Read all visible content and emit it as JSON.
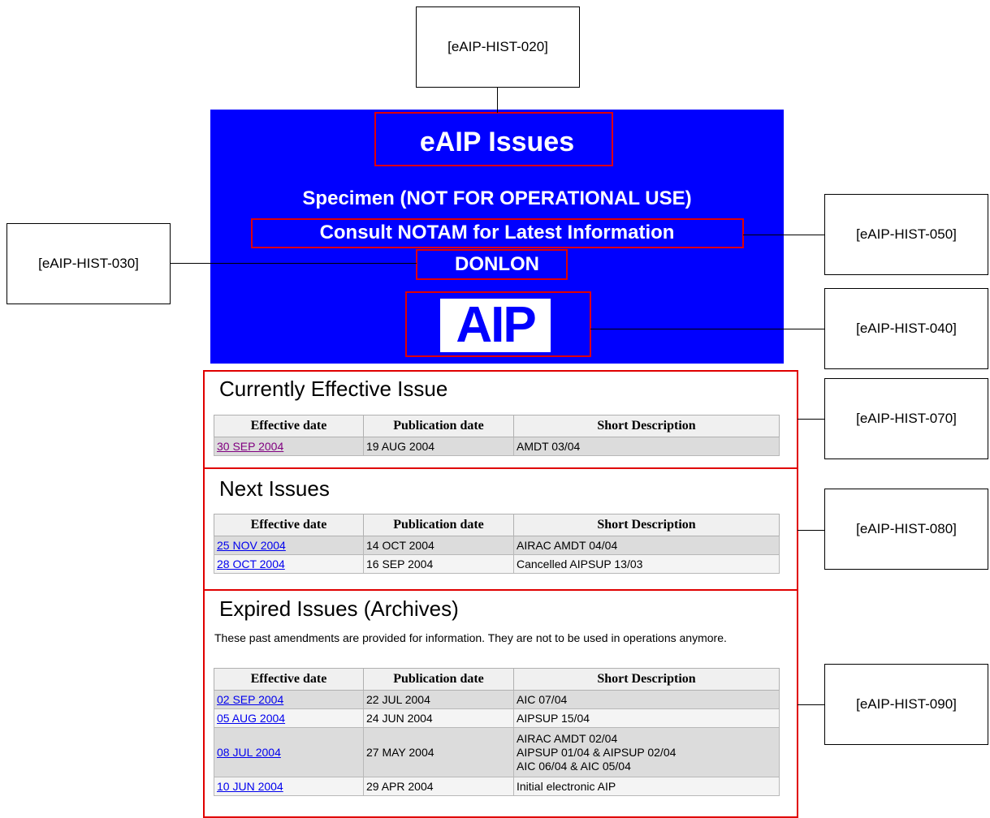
{
  "callouts": {
    "c020": "[eAIP-HIST-020]",
    "c030": "[eAIP-HIST-030]",
    "c050": "[eAIP-HIST-050]",
    "c040": "[eAIP-HIST-040]",
    "c070": "[eAIP-HIST-070]",
    "c080": "[eAIP-HIST-080]",
    "c090": "[eAIP-HIST-090]"
  },
  "banner": {
    "title": "eAIP Issues",
    "specimen": "Specimen (NOT FOR OPERATIONAL USE)",
    "notam": "Consult NOTAM for Latest Information",
    "state": "DONLON",
    "logo": "AIP"
  },
  "columns": {
    "effective": "Effective date",
    "publication": "Publication date",
    "description": "Short Description"
  },
  "current": {
    "title": "Currently Effective Issue",
    "rows": [
      {
        "effective": "30 SEP 2004",
        "publication": "19 AUG 2004",
        "description": [
          "AMDT 03/04"
        ]
      }
    ]
  },
  "next": {
    "title": "Next Issues",
    "rows": [
      {
        "effective": "25 NOV 2004",
        "publication": "14 OCT 2004",
        "description": [
          "AIRAC AMDT 04/04"
        ]
      },
      {
        "effective": "28 OCT 2004",
        "publication": "16 SEP 2004",
        "description": [
          "Cancelled AIPSUP 13/03"
        ]
      }
    ]
  },
  "expired": {
    "title": "Expired Issues (Archives)",
    "note": "These past amendments are provided for information. They are not to be used in operations anymore.",
    "rows": [
      {
        "effective": "02 SEP 2004",
        "publication": "22 JUL 2004",
        "description": [
          "AIC 07/04"
        ]
      },
      {
        "effective": "05 AUG 2004",
        "publication": "24 JUN 2004",
        "description": [
          "AIPSUP 15/04"
        ]
      },
      {
        "effective": "08 JUL 2004",
        "publication": "27 MAY 2004",
        "description": [
          "AIRAC AMDT 02/04",
          "AIPSUP 01/04 & AIPSUP 02/04",
          "AIC 06/04 & AIC 05/04"
        ]
      },
      {
        "effective": "10 JUN 2004",
        "publication": "29 APR 2004",
        "description": [
          "Initial electronic AIP"
        ]
      }
    ]
  },
  "colors": {
    "banner_bg": "#0000ff",
    "highlight": "#e00000",
    "link": "#0000ee",
    "visited_link": "#800080"
  }
}
